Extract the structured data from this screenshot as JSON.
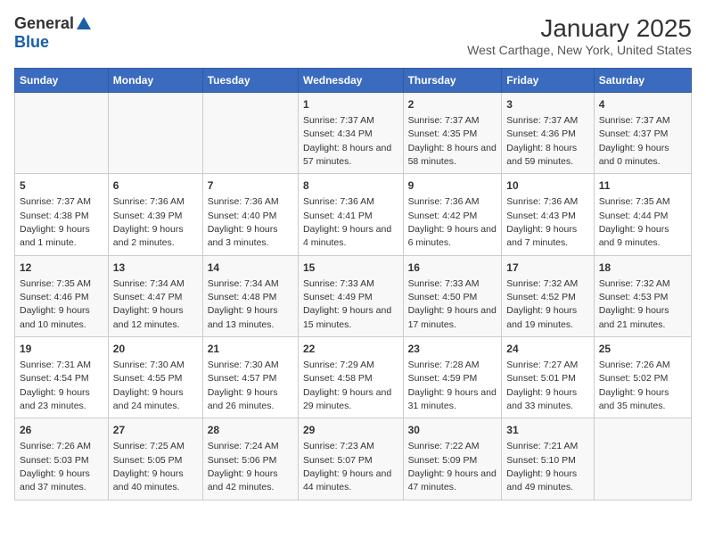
{
  "logo": {
    "general": "General",
    "blue": "Blue"
  },
  "title": "January 2025",
  "subtitle": "West Carthage, New York, United States",
  "days_of_week": [
    "Sunday",
    "Monday",
    "Tuesday",
    "Wednesday",
    "Thursday",
    "Friday",
    "Saturday"
  ],
  "weeks": [
    [
      {
        "day": "",
        "info": ""
      },
      {
        "day": "",
        "info": ""
      },
      {
        "day": "",
        "info": ""
      },
      {
        "day": "1",
        "info": "Sunrise: 7:37 AM\nSunset: 4:34 PM\nDaylight: 8 hours and 57 minutes."
      },
      {
        "day": "2",
        "info": "Sunrise: 7:37 AM\nSunset: 4:35 PM\nDaylight: 8 hours and 58 minutes."
      },
      {
        "day": "3",
        "info": "Sunrise: 7:37 AM\nSunset: 4:36 PM\nDaylight: 8 hours and 59 minutes."
      },
      {
        "day": "4",
        "info": "Sunrise: 7:37 AM\nSunset: 4:37 PM\nDaylight: 9 hours and 0 minutes."
      }
    ],
    [
      {
        "day": "5",
        "info": "Sunrise: 7:37 AM\nSunset: 4:38 PM\nDaylight: 9 hours and 1 minute."
      },
      {
        "day": "6",
        "info": "Sunrise: 7:36 AM\nSunset: 4:39 PM\nDaylight: 9 hours and 2 minutes."
      },
      {
        "day": "7",
        "info": "Sunrise: 7:36 AM\nSunset: 4:40 PM\nDaylight: 9 hours and 3 minutes."
      },
      {
        "day": "8",
        "info": "Sunrise: 7:36 AM\nSunset: 4:41 PM\nDaylight: 9 hours and 4 minutes."
      },
      {
        "day": "9",
        "info": "Sunrise: 7:36 AM\nSunset: 4:42 PM\nDaylight: 9 hours and 6 minutes."
      },
      {
        "day": "10",
        "info": "Sunrise: 7:36 AM\nSunset: 4:43 PM\nDaylight: 9 hours and 7 minutes."
      },
      {
        "day": "11",
        "info": "Sunrise: 7:35 AM\nSunset: 4:44 PM\nDaylight: 9 hours and 9 minutes."
      }
    ],
    [
      {
        "day": "12",
        "info": "Sunrise: 7:35 AM\nSunset: 4:46 PM\nDaylight: 9 hours and 10 minutes."
      },
      {
        "day": "13",
        "info": "Sunrise: 7:34 AM\nSunset: 4:47 PM\nDaylight: 9 hours and 12 minutes."
      },
      {
        "day": "14",
        "info": "Sunrise: 7:34 AM\nSunset: 4:48 PM\nDaylight: 9 hours and 13 minutes."
      },
      {
        "day": "15",
        "info": "Sunrise: 7:33 AM\nSunset: 4:49 PM\nDaylight: 9 hours and 15 minutes."
      },
      {
        "day": "16",
        "info": "Sunrise: 7:33 AM\nSunset: 4:50 PM\nDaylight: 9 hours and 17 minutes."
      },
      {
        "day": "17",
        "info": "Sunrise: 7:32 AM\nSunset: 4:52 PM\nDaylight: 9 hours and 19 minutes."
      },
      {
        "day": "18",
        "info": "Sunrise: 7:32 AM\nSunset: 4:53 PM\nDaylight: 9 hours and 21 minutes."
      }
    ],
    [
      {
        "day": "19",
        "info": "Sunrise: 7:31 AM\nSunset: 4:54 PM\nDaylight: 9 hours and 23 minutes."
      },
      {
        "day": "20",
        "info": "Sunrise: 7:30 AM\nSunset: 4:55 PM\nDaylight: 9 hours and 24 minutes."
      },
      {
        "day": "21",
        "info": "Sunrise: 7:30 AM\nSunset: 4:57 PM\nDaylight: 9 hours and 26 minutes."
      },
      {
        "day": "22",
        "info": "Sunrise: 7:29 AM\nSunset: 4:58 PM\nDaylight: 9 hours and 29 minutes."
      },
      {
        "day": "23",
        "info": "Sunrise: 7:28 AM\nSunset: 4:59 PM\nDaylight: 9 hours and 31 minutes."
      },
      {
        "day": "24",
        "info": "Sunrise: 7:27 AM\nSunset: 5:01 PM\nDaylight: 9 hours and 33 minutes."
      },
      {
        "day": "25",
        "info": "Sunrise: 7:26 AM\nSunset: 5:02 PM\nDaylight: 9 hours and 35 minutes."
      }
    ],
    [
      {
        "day": "26",
        "info": "Sunrise: 7:26 AM\nSunset: 5:03 PM\nDaylight: 9 hours and 37 minutes."
      },
      {
        "day": "27",
        "info": "Sunrise: 7:25 AM\nSunset: 5:05 PM\nDaylight: 9 hours and 40 minutes."
      },
      {
        "day": "28",
        "info": "Sunrise: 7:24 AM\nSunset: 5:06 PM\nDaylight: 9 hours and 42 minutes."
      },
      {
        "day": "29",
        "info": "Sunrise: 7:23 AM\nSunset: 5:07 PM\nDaylight: 9 hours and 44 minutes."
      },
      {
        "day": "30",
        "info": "Sunrise: 7:22 AM\nSunset: 5:09 PM\nDaylight: 9 hours and 47 minutes."
      },
      {
        "day": "31",
        "info": "Sunrise: 7:21 AM\nSunset: 5:10 PM\nDaylight: 9 hours and 49 minutes."
      },
      {
        "day": "",
        "info": ""
      }
    ]
  ]
}
